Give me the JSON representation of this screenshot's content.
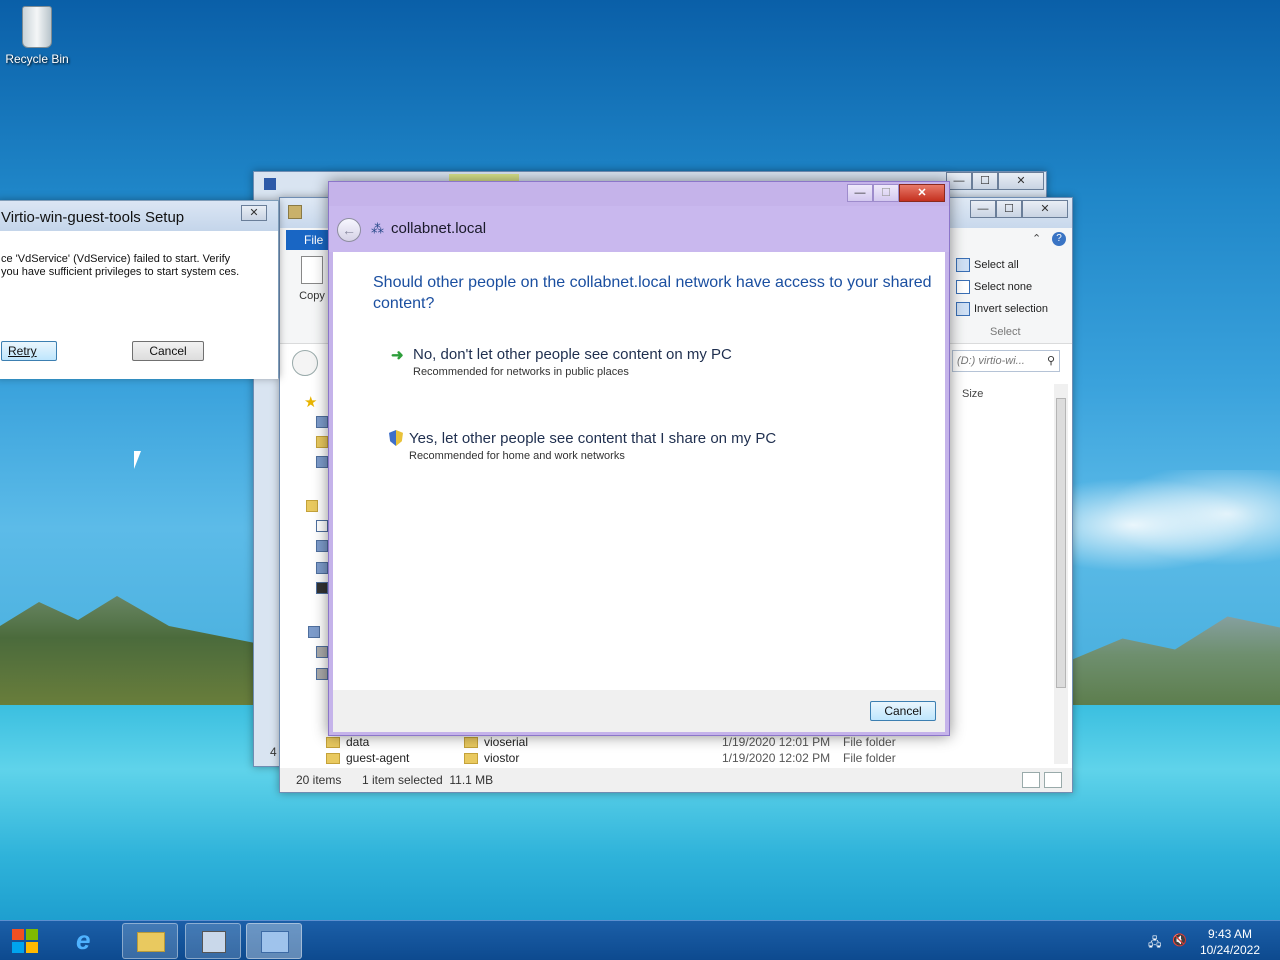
{
  "desktop": {
    "recycle_bin_label": "Recycle Bin"
  },
  "explorer": {
    "file_tab": "File",
    "copy_label": "Copy",
    "select_all": "Select all",
    "select_none": "Select none",
    "invert_selection": "Invert selection",
    "select_group": "Select",
    "address_text": "(D:) virtio-wi...",
    "column_size": "Size",
    "rows": [
      {
        "left": "data",
        "name": "vioserial",
        "date": "1/19/2020 12:01 PM",
        "type": "File folder"
      },
      {
        "left": "guest-agent",
        "name": "viostor",
        "date": "1/19/2020 12:02 PM",
        "type": "File folder"
      }
    ],
    "left_count": "4",
    "status_items": "20 items",
    "status_selected": "1 item selected  11.1 MB"
  },
  "setup_dialog": {
    "title": "Virtio-win-guest-tools Setup",
    "message": "ce 'VdService' (VdService) failed to start.  Verify you have sufficient privileges to start system ces.",
    "retry": "Retry",
    "cancel": "Cancel"
  },
  "network_dialog": {
    "title": "collabnet.local",
    "question": "Should other people on the collabnet.local network have access to your shared content?",
    "option_no": "No, don't let other people see content on my PC",
    "option_no_sub": "Recommended for networks in public places",
    "option_yes": "Yes, let other people see content that I share on my PC",
    "option_yes_sub": "Recommended for home and work networks",
    "cancel": "Cancel"
  },
  "taskbar": {
    "time": "9:43 AM",
    "date": "10/24/2022"
  }
}
